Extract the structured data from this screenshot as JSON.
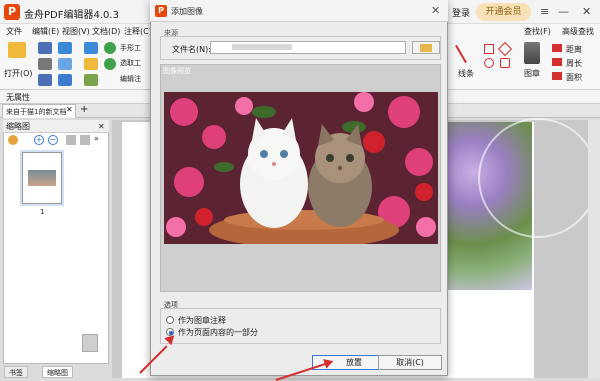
{
  "app": {
    "title": "金舟PDF编辑器4.0.3",
    "login": "登录",
    "vip": "开通会员",
    "logo": "P"
  },
  "menu": [
    "文件",
    "编辑(E)",
    "视图(V)",
    "文档(D)",
    "注释(C)"
  ],
  "ribbon": {
    "open_label": "打开(O)",
    "hand_tool": "手形工",
    "select_tool": "选取工",
    "edit_tool": "编辑注",
    "stamp": "图章",
    "lines": "线条",
    "find": "查找(F)",
    "advanced_find": "高级查找",
    "distance": "距离",
    "perimeter": "周长",
    "area": "面积"
  },
  "properties_bar": "无属性",
  "doc_tab": "来自于猫1的新文档",
  "thumbnail_panel": {
    "title": "缩略图",
    "page_number": "1"
  },
  "bottom_tabs": {
    "bookmarks": "书签",
    "thumbnails": "缩略图"
  },
  "dialog": {
    "logo": "P",
    "title": "添加图像",
    "close": "✕",
    "source_label": "来源",
    "file_name_label": "文件名(N):",
    "file_name_value": "",
    "preview_label": "图像预览",
    "options_label": "选项",
    "options": [
      {
        "label": "作为图章注释",
        "selected": false
      },
      {
        "label": "作为页面内容的一部分",
        "selected": true
      }
    ],
    "ok_button": "放置",
    "cancel_button": "取消(C)"
  }
}
